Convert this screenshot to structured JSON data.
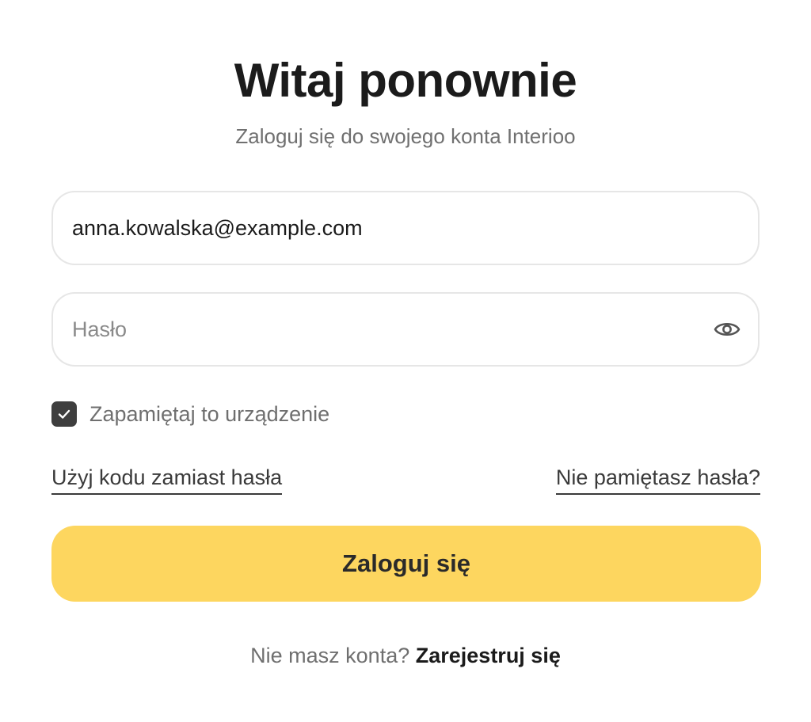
{
  "header": {
    "title": "Witaj ponownie",
    "subtitle": "Zaloguj się do swojego konta Interioo"
  },
  "form": {
    "email": {
      "value": "anna.kowalska@example.com",
      "placeholder": ""
    },
    "password": {
      "value": "",
      "placeholder": "Hasło",
      "toggle_icon": "eye-icon"
    },
    "remember": {
      "label": "Zapamiętaj to urządzenie",
      "checked": true,
      "icon": "checkmark-icon"
    },
    "links": {
      "use_code": "Użyj kodu zamiast hasła",
      "forgot_password": "Nie pamiętasz hasła?"
    },
    "submit_label": "Zaloguj się"
  },
  "footer": {
    "prompt": "Nie masz konta?",
    "signup_label": "Zarejestruj się"
  },
  "colors": {
    "accent": "#fdd65f",
    "checkbox": "#3e3e3e",
    "text_primary": "#1b1b1b",
    "text_muted": "#707070",
    "field_border": "#e6e6e6"
  }
}
